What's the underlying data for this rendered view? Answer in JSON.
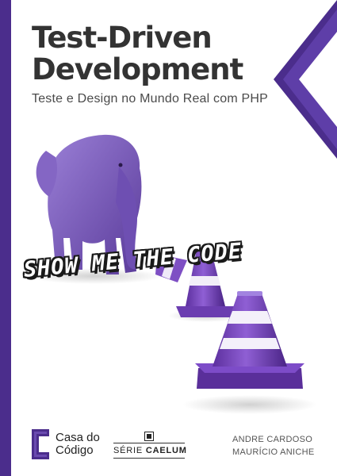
{
  "book": {
    "title_line1": "Test-Driven",
    "title_line2": "Development",
    "subtitle": "Teste e Design no Mundo Real com PHP",
    "banner": "SHOW ME THE CODE"
  },
  "publisher": {
    "name_line1": "Casa do",
    "name_line2": "Código"
  },
  "series": {
    "prefix": "SÉRIE",
    "name": "CAELUM"
  },
  "authors": [
    "ANDRE CARDOSO",
    "MAURÍCIO ANICHE"
  ],
  "colors": {
    "brand_purple": "#4b2d8c",
    "cone_purple": "#7a4bb8",
    "text_dark": "#333333"
  },
  "icons": [
    "casa-do-codigo-logo-icon",
    "caelum-icon"
  ]
}
